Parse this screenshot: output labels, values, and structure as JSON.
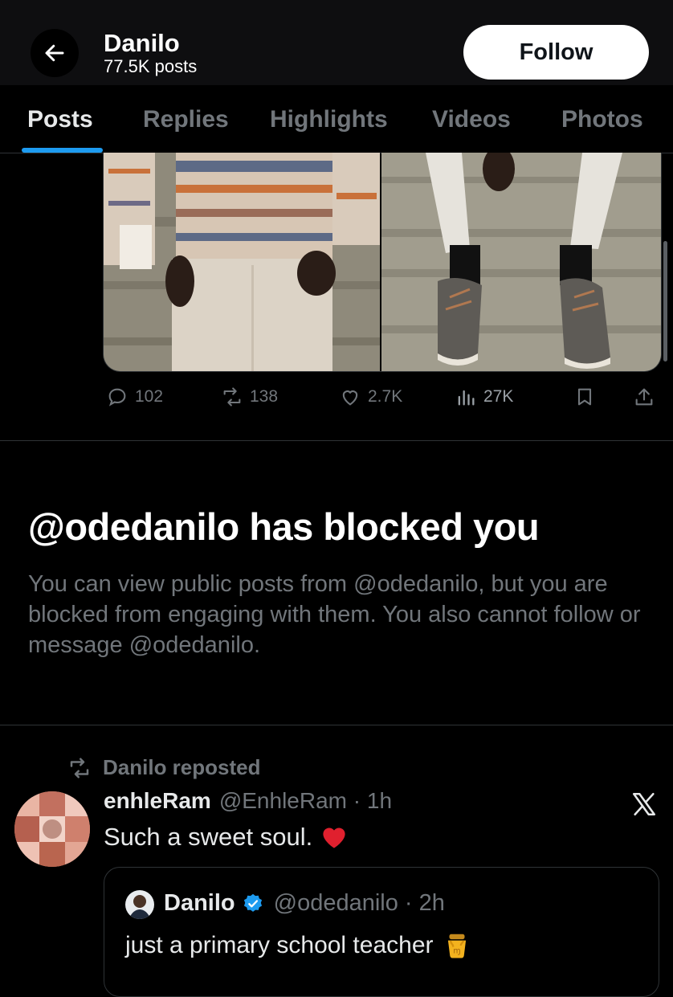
{
  "header": {
    "name": "Danilo",
    "post_count": "77.5K posts",
    "follow_label": "Follow"
  },
  "tabs": [
    {
      "label": "Posts",
      "active": true
    },
    {
      "label": "Replies",
      "active": false
    },
    {
      "label": "Highlights",
      "active": false
    },
    {
      "label": "Videos",
      "active": false
    },
    {
      "label": "Photos",
      "active": false
    }
  ],
  "post_actions": {
    "replies": "102",
    "reposts": "138",
    "likes": "2.7K",
    "views": "27K"
  },
  "blocked": {
    "title": "@odedanilo has blocked you",
    "description": "You can view public posts from @odedanilo, but you are blocked from engaging with them. You also cannot follow or message @odedanilo."
  },
  "repost": {
    "label": "Danilo reposted",
    "author_name": "enhleRam",
    "author_handle": "@EnhleRam · 1h",
    "text": "Such a sweet soul.",
    "quoted": {
      "author_name": "Danilo",
      "author_handle": "@odedanilo · 2h",
      "text": "just a primary school teacher"
    }
  },
  "colors": {
    "accent": "#1d9bf0",
    "muted_text": "#71767b",
    "divider": "#2f3336"
  },
  "icons": [
    "back-arrow-icon",
    "reply-icon",
    "repost-icon",
    "like-icon",
    "views-icon",
    "bookmark-icon",
    "share-icon",
    "x-logo-icon",
    "verified-badge-icon",
    "heart-emoji-icon",
    "honey-pot-emoji-icon"
  ]
}
